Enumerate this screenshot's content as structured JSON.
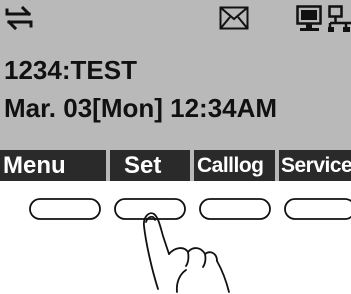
{
  "status_bar": {
    "icons": [
      "handset-arrows-icon",
      "envelope-icon",
      "computer-icon",
      "network-icon"
    ]
  },
  "display": {
    "line1": "1234:TEST",
    "line2": "Mar. 03[Mon] 12:34AM"
  },
  "softkeys": [
    {
      "label": "Menu"
    },
    {
      "label": "Set"
    },
    {
      "label": "Calllog"
    },
    {
      "label": "Service"
    }
  ],
  "colors": {
    "lcd_background": "#b9b9b9",
    "softkey_background": "#2a2a2a",
    "softkey_text": "#ffffff"
  }
}
